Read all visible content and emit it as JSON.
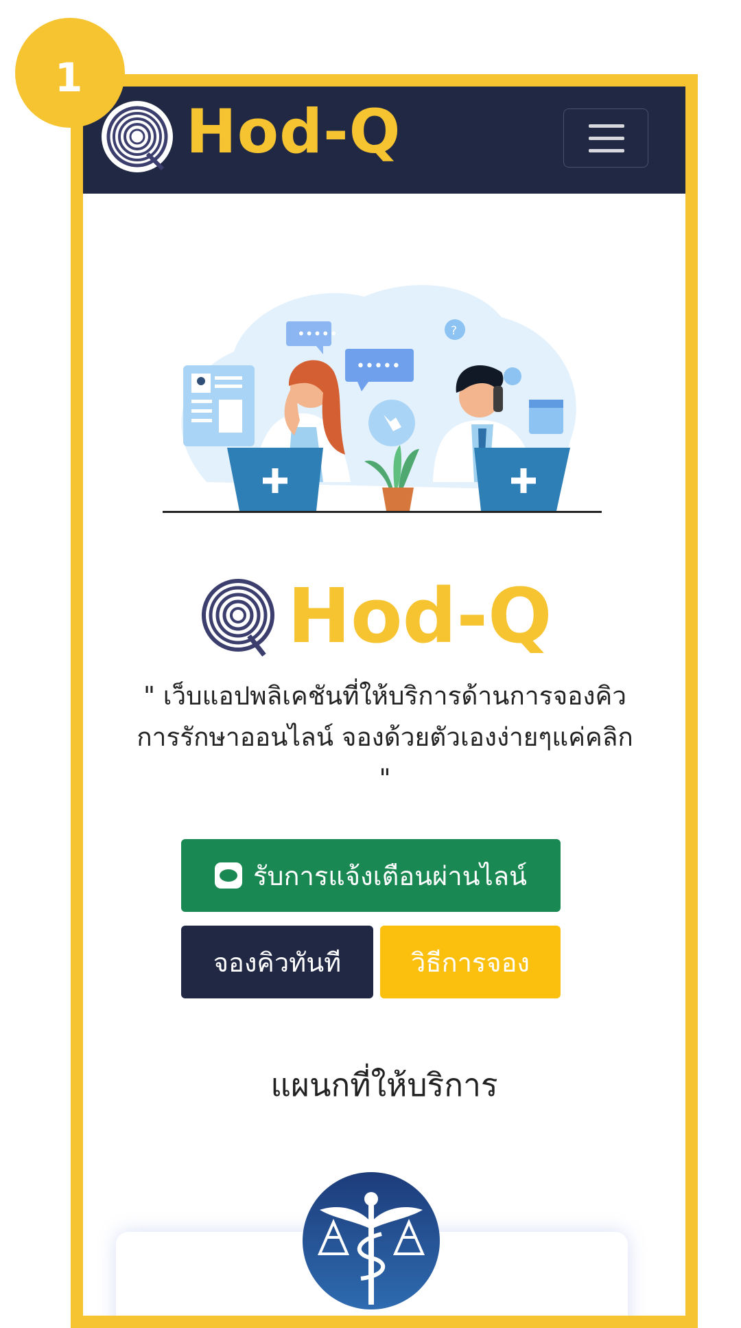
{
  "step": {
    "number": "1"
  },
  "navbar": {
    "brand": "Hod-Q",
    "logo_icon": "concentric-circle-logo-icon",
    "menu_icon": "hamburger-menu-icon"
  },
  "hero": {
    "illustration": "call-center-doctors-illustration"
  },
  "logo": {
    "brand": "Hod-Q"
  },
  "tagline": {
    "line1": "\" เว็บแอปพลิเคชันที่ให้บริการด้านการจองคิว",
    "line2": "การรักษาออนไลน์ จองด้วยตัวเองง่ายๆแค่คลิก",
    "line3": "\""
  },
  "buttons": {
    "line_notify": "รับการแจ้งเตือนผ่านไลน์",
    "book_now": "จองคิวทันที",
    "how_to": "วิธีการจอง"
  },
  "departments": {
    "title": "แผนกที่ให้บริการ"
  },
  "colors": {
    "navy": "#212844",
    "yellow": "#f6c431",
    "green": "#1a8853",
    "amber": "#fbbf0d"
  }
}
